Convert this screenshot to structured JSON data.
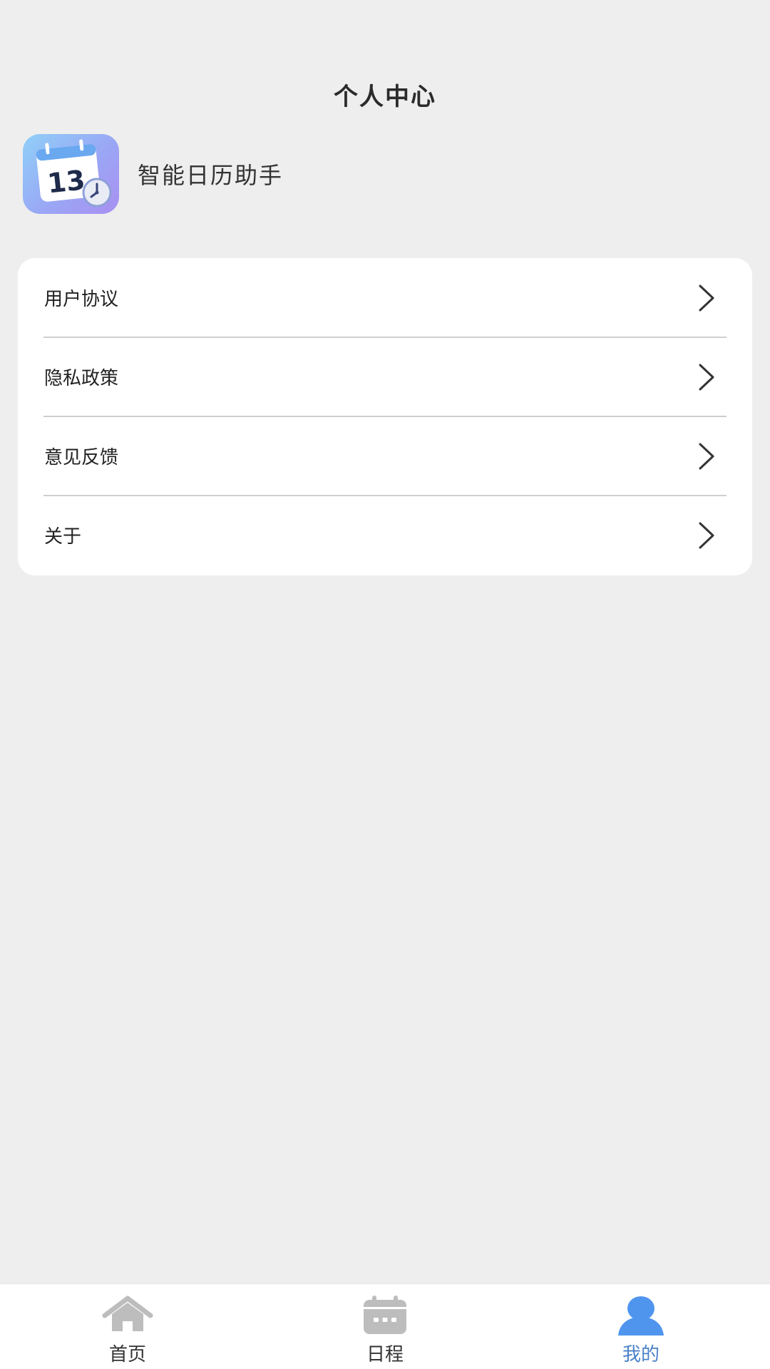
{
  "header": {
    "title": "个人中心"
  },
  "profile": {
    "app_name": "智能日历助手",
    "icon_day": "13"
  },
  "menu": {
    "items": [
      {
        "label": "用户协议"
      },
      {
        "label": "隐私政策"
      },
      {
        "label": "意见反馈"
      },
      {
        "label": "关于"
      }
    ]
  },
  "tabbar": {
    "tabs": [
      {
        "label": "首页",
        "icon": "home-icon",
        "active": false
      },
      {
        "label": "日程",
        "icon": "calendar-icon",
        "active": false
      },
      {
        "label": "我的",
        "icon": "user-icon",
        "active": true
      }
    ]
  },
  "colors": {
    "background": "#eeeeee",
    "card": "#ffffff",
    "active_tab": "#4a82c8",
    "inactive_icon": "#bdbdbd"
  }
}
